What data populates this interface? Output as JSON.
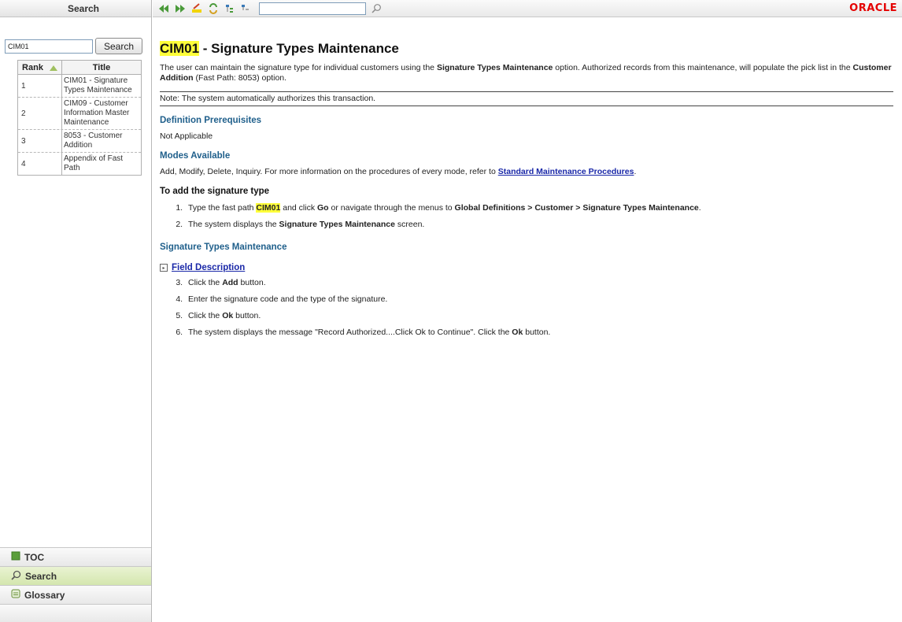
{
  "left_pane": {
    "header": "Search",
    "search_value": "CIM01",
    "search_button": "Search",
    "results": {
      "col_rank": "Rank",
      "col_title": "Title",
      "rows": [
        {
          "rank": "1",
          "title": "CIM01 - Signature Types Maintenance"
        },
        {
          "rank": "2",
          "title": "CIM09 - Customer Information Master Maintenance"
        },
        {
          "rank": "3",
          "title": "8053 - Customer Addition"
        },
        {
          "rank": "4",
          "title": "Appendix of Fast Path"
        }
      ]
    },
    "tabs": [
      {
        "label": "TOC",
        "icon": "book-icon"
      },
      {
        "label": "Search",
        "icon": "search-icon"
      },
      {
        "label": "Glossary",
        "icon": "glossary-icon"
      }
    ],
    "active_tab": "Search"
  },
  "toolbar": {
    "brand": "ORACLE"
  },
  "content": {
    "title_code": "CIM01",
    "title_rest": " - Signature Types Maintenance",
    "intro": {
      "p1": "The user can maintain the signature type for individual customers using the ",
      "b1": "Signature Types Maintenance",
      "p2": " option. Authorized records from this maintenance, will populate the pick list in the ",
      "b2": "Customer Addition",
      "p3": " (Fast Path: 8053) option."
    },
    "note": "Note: The system automatically authorizes this transaction.",
    "def_prereq_heading": "Definition Prerequisites",
    "def_prereq_text": "Not Applicable",
    "modes_heading": "Modes Available",
    "modes_text": "Add, Modify, Delete, Inquiry. For more information on the procedures of every mode, refer to ",
    "modes_link": "Standard Maintenance Procedures",
    "modes_end": ".",
    "proc_heading": "To add the signature type",
    "step1": {
      "t1": "Type the fast path ",
      "code": "CIM01",
      "t2": " and click ",
      "go": "Go",
      "t3": " or navigate through the menus to ",
      "path": "Global Definitions > Customer > Signature Types Maintenance",
      "t4": "."
    },
    "step2": {
      "t1": "The system displays the ",
      "b": "Signature Types Maintenance",
      "t2": " screen."
    },
    "screen_heading": "Signature Types Maintenance",
    "field_desc_link": "Field Description",
    "step3": {
      "t1": "Click the ",
      "b": "Add",
      "t2": " button."
    },
    "step4": "Enter the signature code and the type of the signature.",
    "step5": {
      "t1": "Click the ",
      "b": "Ok",
      "t2": " button."
    },
    "step6": {
      "t1": "The system displays the message \"Record Authorized....Click Ok to Continue\". Click the ",
      "b": "Ok",
      "t2": " button."
    }
  }
}
